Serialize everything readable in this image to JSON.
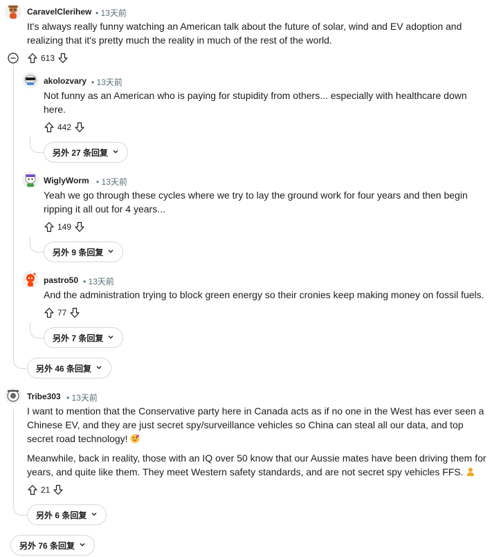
{
  "comments": [
    {
      "author": "CaravelClerihew",
      "time": "13天前",
      "body": [
        "It's always really funny watching an American talk about the future of solar, wind and EV adoption and realizing that it's pretty much the reality in much of the rest of the world."
      ],
      "score": "613",
      "replies": [
        {
          "author": "akolozvary",
          "time": "13天前",
          "body": [
            "Not funny as an American who is paying for stupidity from others... especially with healthcare down here."
          ],
          "score": "442",
          "more": "另外 27 条回复"
        },
        {
          "author": "WiglyWorm",
          "time": "13天前",
          "body": [
            "Yeah we go through these cycles where we try to lay the ground work for four years and then begin ripping it all out for 4 years..."
          ],
          "score": "149",
          "more": "另外 9 条回复"
        },
        {
          "author": "pastro50",
          "time": "13天前",
          "body": [
            "And the administration trying to block green energy so their cronies keep making money on fossil fuels."
          ],
          "score": "77",
          "more": "另外 7 条回复"
        }
      ],
      "more": "另外 46 条回复"
    },
    {
      "author": "Tribe303",
      "time": "13天前",
      "body": [
        "I want to mention that the Conservative party here in Canada acts as if no one in the West has ever seen a Chinese EV, and they are just secret spy/surveillance vehicles so China can steal all our data, and top secret road technology!",
        "Meanwhile, back in reality, those with an IQ over 50 know that our Aussie mates have been driving them for years, and quite like them. They meet Western safety standards, and are not secret spy vehicles FFS."
      ],
      "score": "21",
      "more": "另外 6 条回复"
    }
  ],
  "root_more": "另外 76 条回复",
  "separator": "•",
  "icons": {
    "upvote": "upvote-icon",
    "downvote": "downvote-icon",
    "collapse": "collapse-minus-icon",
    "chevron": "chevron-down-icon"
  }
}
